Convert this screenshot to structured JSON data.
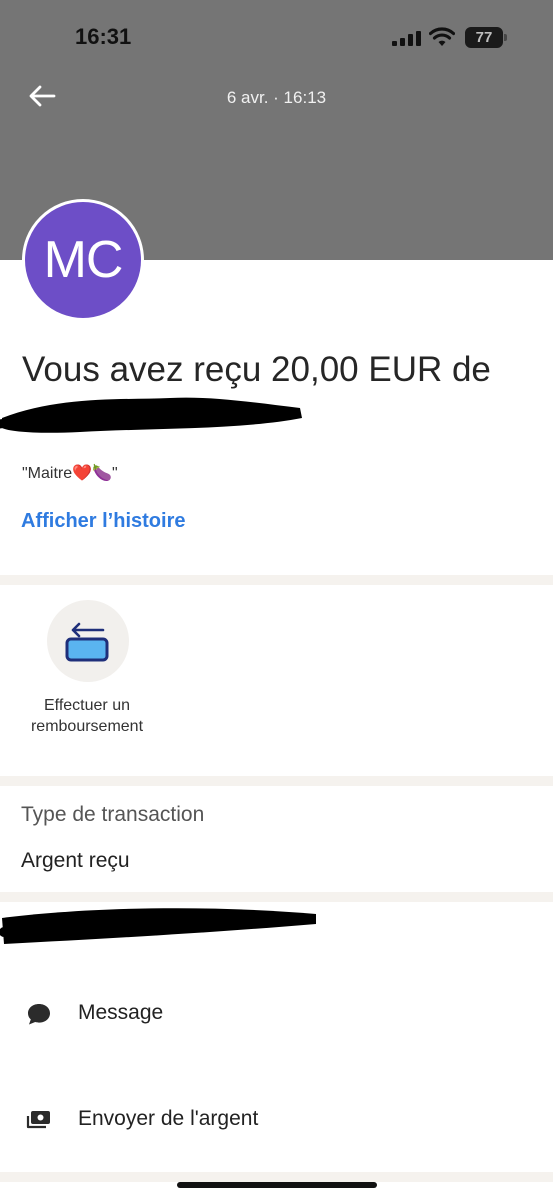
{
  "status_bar": {
    "time": "16:31",
    "battery": "77"
  },
  "header": {
    "date": "6 avr. · 16:13"
  },
  "avatar": {
    "initials": "MC",
    "color": "#6d4ec7"
  },
  "transaction": {
    "title": "Vous avez reçu 20,00 EUR de",
    "note": "\"Maitre❤️🍆\"",
    "story_link": "Afficher l’histoire"
  },
  "refund": {
    "label": "Effectuer un remboursement",
    "icon": "refund-icon"
  },
  "details": {
    "type_label": "Type de transaction",
    "type_value": "Argent reçu"
  },
  "actions": [
    {
      "label": "Message",
      "icon": "chat-bubble-icon"
    },
    {
      "label": "Envoyer de l'argent",
      "icon": "send-money-icon"
    }
  ],
  "colors": {
    "header_bg": "#757575",
    "link": "#2f7be0",
    "separator": "#f5f2ee"
  }
}
